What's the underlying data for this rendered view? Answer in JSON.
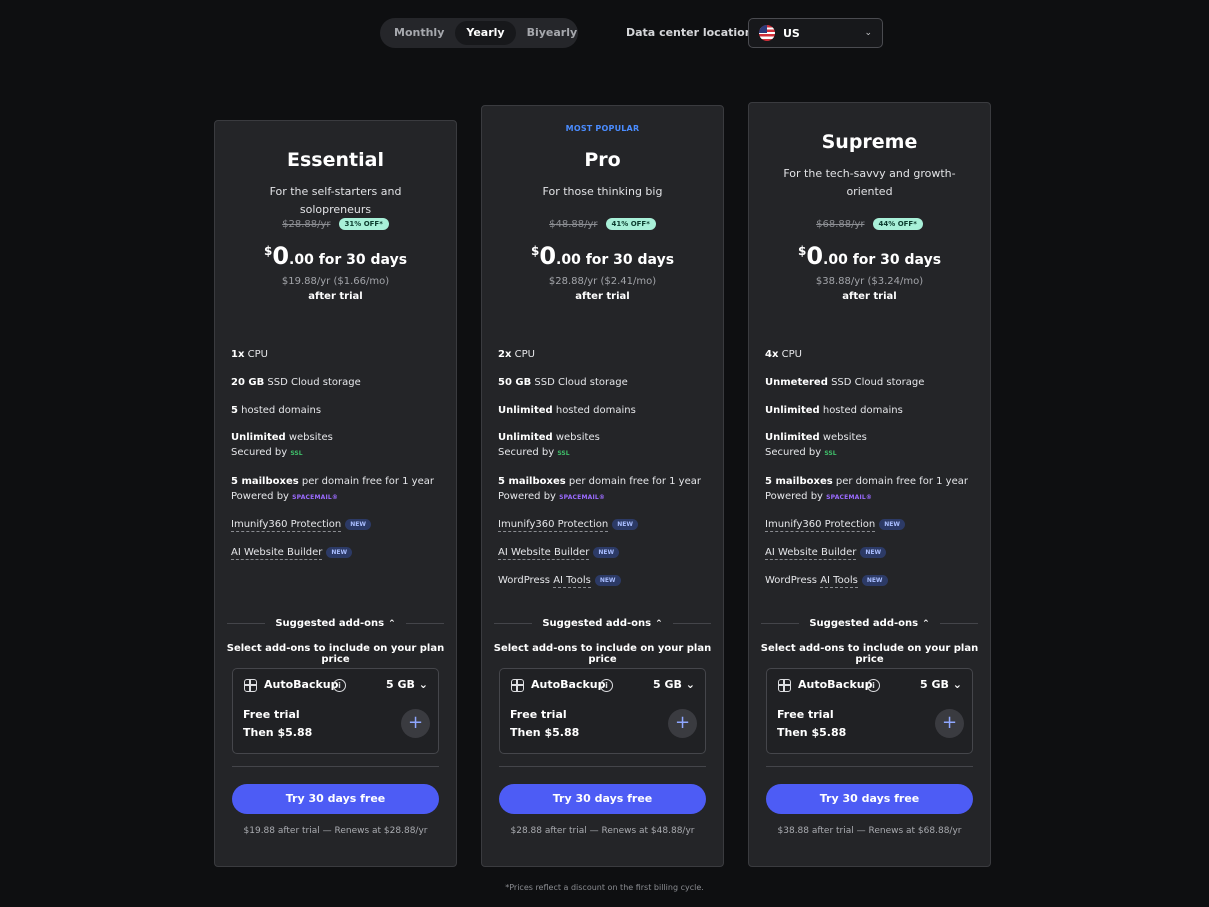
{
  "billing": {
    "options": [
      "Monthly",
      "Yearly",
      "Biyearly"
    ],
    "active": "Yearly"
  },
  "datacenter": {
    "label": "Data center location",
    "value": "US",
    "flag_icon": "us-flag-icon"
  },
  "popular_label": "MOST POPULAR",
  "plans": [
    {
      "name": "Essential",
      "desc": "For the self-starters and solopreneurs",
      "old_price": "$28.88/yr",
      "off": "31% OFF*",
      "currency": "$",
      "big": "0",
      "rest": ".00 for 30 days",
      "after_price": "$19.88/yr ($1.66/mo)",
      "after_trial": "after trial",
      "f_cpu_b": "1x",
      "f_cpu": " CPU",
      "f_storage_b": "20 GB",
      "f_storage": " SSD Cloud storage",
      "f_domains_b": "5",
      "f_domains": " hosted domains",
      "f_sites_b": "Unlimited",
      "f_sites": " websites",
      "f_secured": "Secured by ",
      "f_ssl": "SSL",
      "f_mail_b": "5 mailboxes",
      "f_mail": " per domain free for 1 year",
      "f_powered": "Powered by ",
      "f_spacemail": "SPACEMAIL®",
      "f_imunify": "Imunify360 Protection",
      "f_builder": "AI Website Builder",
      "new": "NEW",
      "renew": "$19.88 after trial — Renews at $28.88/yr"
    },
    {
      "name": "Pro",
      "desc": "For those thinking big",
      "old_price": "$48.88/yr",
      "off": "41% OFF*",
      "currency": "$",
      "big": "0",
      "rest": ".00 for 30 days",
      "after_price": "$28.88/yr ($2.41/mo)",
      "after_trial": "after trial",
      "f_cpu_b": "2x",
      "f_cpu": " CPU",
      "f_storage_b": "50 GB",
      "f_storage": " SSD Cloud storage",
      "f_domains_b": "Unlimited",
      "f_domains": " hosted domains",
      "f_sites_b": "Unlimited",
      "f_sites": " websites",
      "f_secured": "Secured by ",
      "f_ssl": "SSL",
      "f_mail_b": "5 mailboxes",
      "f_mail": " per domain free for 1 year",
      "f_powered": "Powered by ",
      "f_spacemail": "SPACEMAIL®",
      "f_imunify": "Imunify360 Protection",
      "f_builder": "AI Website Builder",
      "f_wp": "WordPress ",
      "f_wp_ai": "AI Tools",
      "new": "NEW",
      "renew": "$28.88 after trial — Renews at $48.88/yr"
    },
    {
      "name": "Supreme",
      "desc": "For the tech-savvy and growth-oriented",
      "old_price": "$68.88/yr",
      "off": "44% OFF*",
      "currency": "$",
      "big": "0",
      "rest": ".00 for 30 days",
      "after_price": "$38.88/yr ($3.24/mo)",
      "after_trial": "after trial",
      "f_cpu_b": "4x",
      "f_cpu": " CPU",
      "f_storage_b": "Unmetered",
      "f_storage": " SSD Cloud storage",
      "f_domains_b": "Unlimited",
      "f_domains": " hosted domains",
      "f_sites_b": "Unlimited",
      "f_sites": " websites",
      "f_secured": "Secured by ",
      "f_ssl": "SSL",
      "f_mail_b": "5 mailboxes",
      "f_mail": " per domain free for 1 year",
      "f_powered": "Powered by ",
      "f_spacemail": "SPACEMAIL®",
      "f_imunify": "Imunify360 Protection",
      "f_builder": "AI Website Builder",
      "f_wp": "WordPress ",
      "f_wp_ai": "AI Tools",
      "new": "NEW",
      "renew": "$38.88 after trial — Renews at $68.88/yr"
    }
  ],
  "addons": {
    "title": "Suggested add-ons",
    "hint": "Select add-ons to include on your plan price",
    "name": "AutoBackup",
    "info": "i",
    "size": "5 GB",
    "trial": "Free trial",
    "then": "Then $5.88",
    "add": "+"
  },
  "cta": "Try 30 days free",
  "footnote": "*Prices reflect a discount on the first billing cycle.",
  "colors": {
    "accent": "#4d5cf5",
    "popular": "#4a8cff",
    "off_pill": "#a8f0d8",
    "background": "#0e0f11",
    "card": "#242528"
  }
}
